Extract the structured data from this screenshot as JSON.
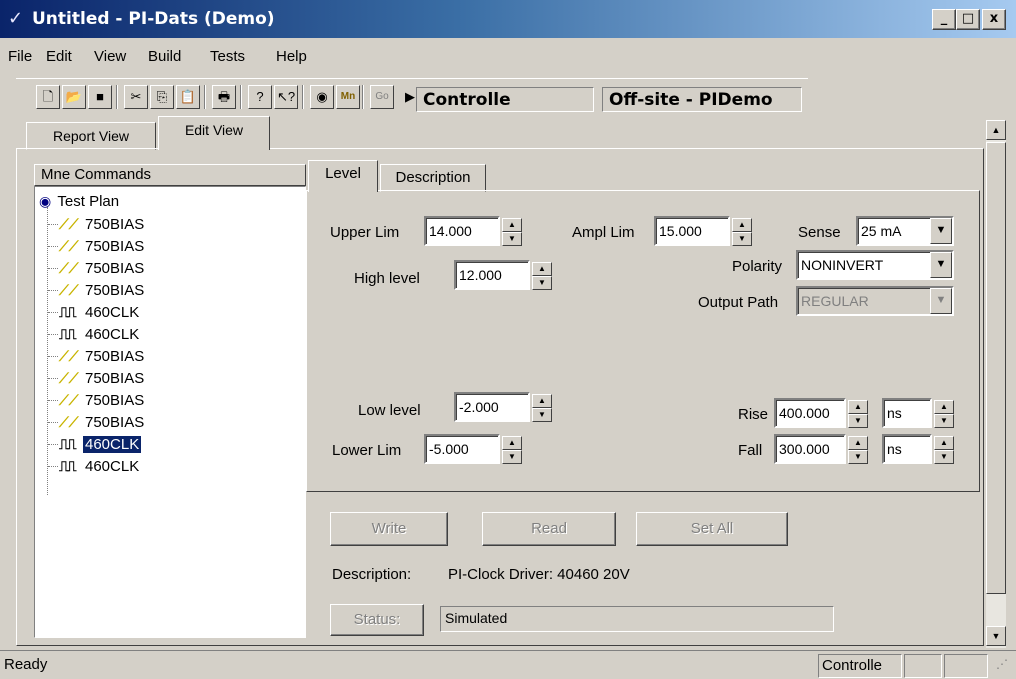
{
  "window": {
    "title": "Untitled - PI-Dats (Demo)",
    "buttons": {
      "minimize": "_",
      "maximize": "□",
      "close": "x"
    }
  },
  "menu": [
    "File",
    "Edit",
    "View",
    "Build",
    "Tests",
    "Help"
  ],
  "toolbar": {
    "controller_label": "Controlle",
    "site_label": "Off-site - PIDemo",
    "icons": [
      "new-icon",
      "open-icon",
      "save-icon",
      "cut-icon",
      "copy-icon",
      "paste-icon",
      "print-icon",
      "help-icon",
      "context-help-icon",
      "view-icon",
      "mn-icon",
      "go-icon",
      "run-icon"
    ],
    "mn": "Mn",
    "go": "Go"
  },
  "outer_tabs": [
    "Report View",
    "Edit View"
  ],
  "tree": {
    "header": "Mne Commands",
    "root": "Test Plan",
    "items": [
      {
        "label": "750BIAS",
        "kind": "bias"
      },
      {
        "label": "750BIAS",
        "kind": "bias"
      },
      {
        "label": "750BIAS",
        "kind": "bias"
      },
      {
        "label": "750BIAS",
        "kind": "bias"
      },
      {
        "label": "460CLK",
        "kind": "clock"
      },
      {
        "label": "460CLK",
        "kind": "clock"
      },
      {
        "label": "750BIAS",
        "kind": "bias"
      },
      {
        "label": "750BIAS",
        "kind": "bias"
      },
      {
        "label": "750BIAS",
        "kind": "bias"
      },
      {
        "label": "750BIAS",
        "kind": "bias"
      },
      {
        "label": "460CLK",
        "kind": "clock",
        "selected": true
      },
      {
        "label": "460CLK",
        "kind": "clock"
      }
    ]
  },
  "inner_tabs": [
    "Level",
    "Description"
  ],
  "level": {
    "upper_lim_label": "Upper Lim",
    "upper_lim": "14.000",
    "ampl_lim_label": "Ampl Lim",
    "ampl_lim": "15.000",
    "sense_label": "Sense",
    "sense": "25 mA",
    "polarity_label": "Polarity",
    "polarity": "NONINVERT",
    "output_path_label": "Output Path",
    "output_path": "REGULAR",
    "high_level_label": "High level",
    "high_level": "12.000",
    "low_level_label": "Low level",
    "low_level": "-2.000",
    "lower_lim_label": "Lower Lim",
    "lower_lim": "-5.000",
    "rise_label": "Rise",
    "rise": "400.000",
    "rise_unit": "ns",
    "fall_label": "Fall",
    "fall": "300.000",
    "fall_unit": "ns"
  },
  "buttons": {
    "write": "Write",
    "read": "Read",
    "set_all": "Set All",
    "status": "Status:"
  },
  "description_label": "Description:",
  "description": "PI-Clock Driver: 40460 20V",
  "status_value": "Simulated",
  "statusbar": {
    "text": "Ready",
    "controller": "Controlle"
  },
  "colors": {
    "face": "#d4d0c8",
    "title_start": "#0a246a",
    "title_end": "#a6caf0",
    "selection": "#0a246a"
  }
}
